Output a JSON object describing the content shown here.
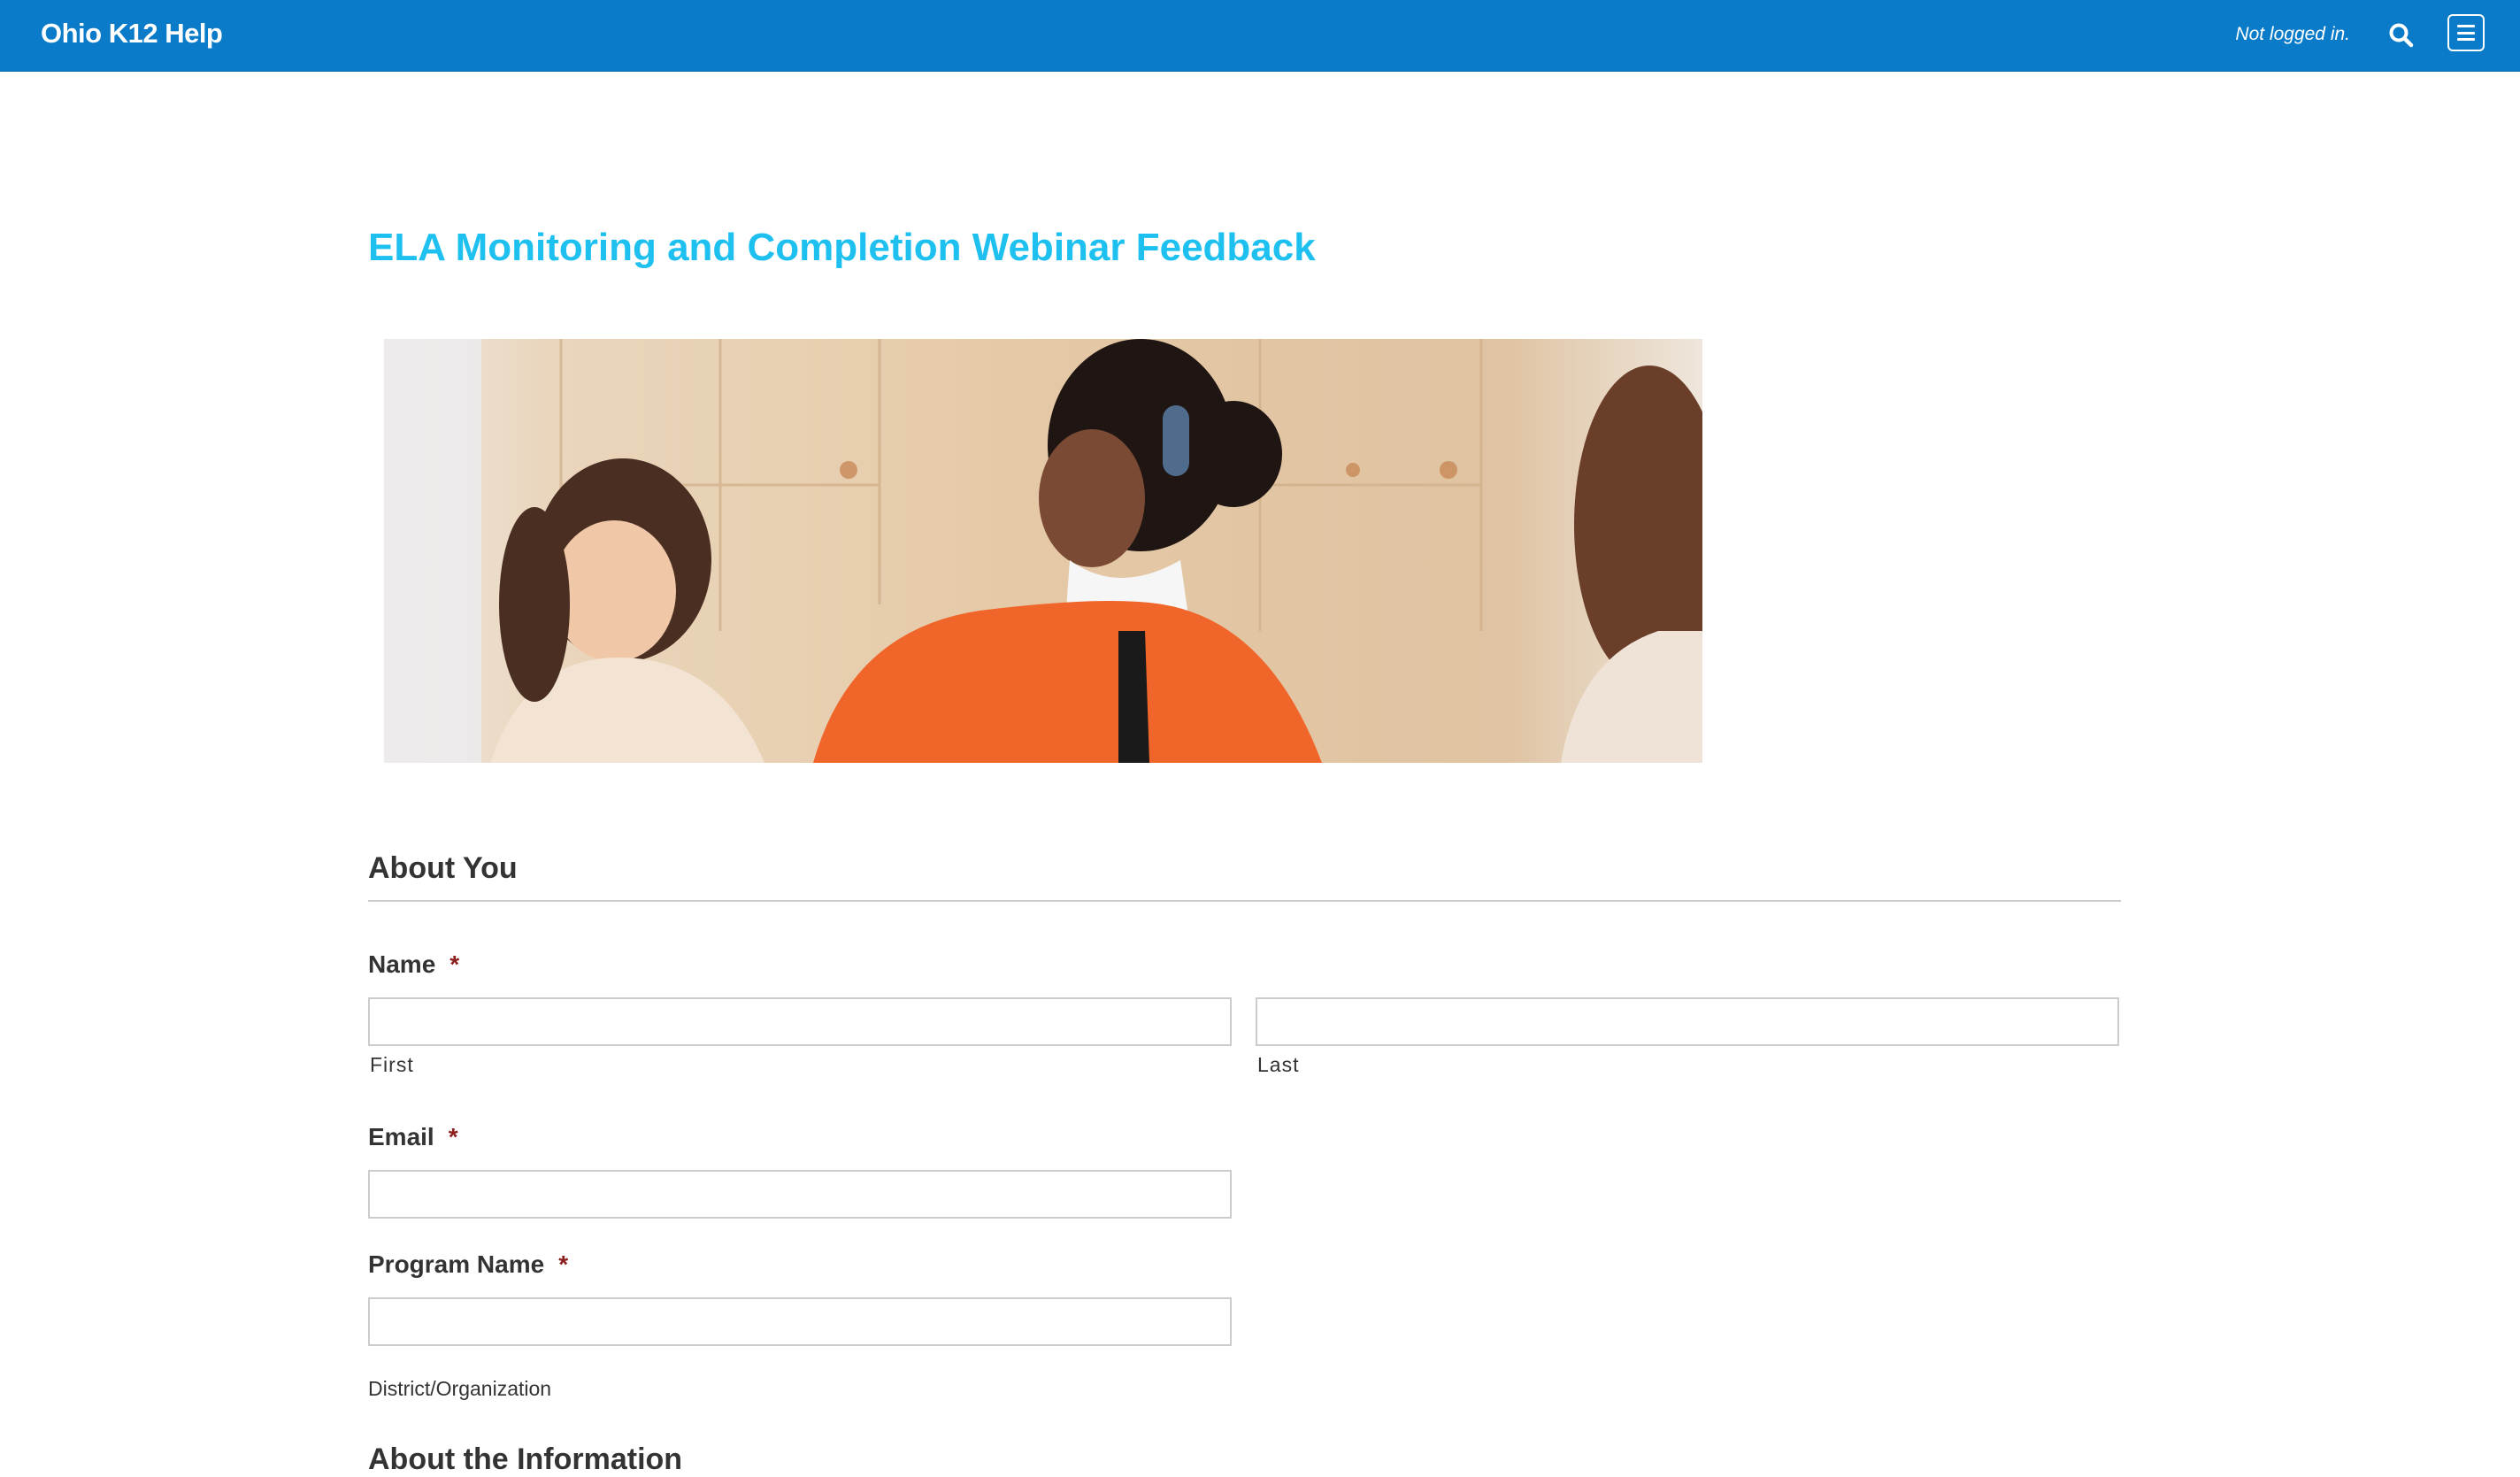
{
  "header": {
    "site_title": "Ohio K12 Help",
    "login_status": "Not logged in.",
    "search_icon": "search-icon",
    "menu_icon": "menu-icon",
    "background_color": "#0a7bc8"
  },
  "form": {
    "title": "ELA Monitoring and Completion Webinar Feedback",
    "title_color": "#1ec0f0",
    "sections": [
      {
        "title": "About You"
      },
      {
        "title": "About the Information"
      }
    ],
    "fields": {
      "name": {
        "label": "Name",
        "required_marker": "*",
        "first_sublabel": "First",
        "last_sublabel": "Last",
        "first_value": "",
        "last_value": ""
      },
      "email": {
        "label": "Email",
        "required_marker": "*",
        "value": ""
      },
      "program_name": {
        "label": "Program Name",
        "required_marker": "*",
        "value": "",
        "description": "District/Organization"
      }
    }
  }
}
